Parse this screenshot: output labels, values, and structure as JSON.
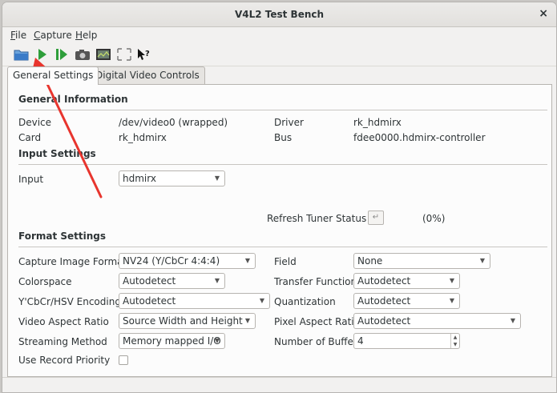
{
  "window": {
    "title": "V4L2 Test Bench"
  },
  "menu": [
    {
      "mnemonic": "F",
      "rest": "ile"
    },
    {
      "mnemonic": "C",
      "rest": "apture"
    },
    {
      "mnemonic": "H",
      "rest": "elp"
    }
  ],
  "toolbar_icons": [
    "open-folder-icon",
    "start-capture-icon",
    "step-capture-icon",
    "snapshot-camera-icon",
    "video-display-icon",
    "fullscreen-icon",
    "whats-this-help-icon"
  ],
  "tabs": [
    {
      "label": "General Settings",
      "active": true
    },
    {
      "label": "Digital Video Controls",
      "active": false
    }
  ],
  "general_info": {
    "heading": "General Information",
    "device_label": "Device",
    "device_value": "/dev/video0 (wrapped)",
    "driver_label": "Driver",
    "driver_value": "rk_hdmirx",
    "card_label": "Card",
    "card_value": "rk_hdmirx",
    "bus_label": "Bus",
    "bus_value": "fdee0000.hdmirx-controller"
  },
  "input_settings": {
    "heading": "Input Settings",
    "input_label": "Input",
    "input_value": "hdmirx",
    "refresh_label": "Refresh Tuner Status",
    "refresh_pct": "(0%)"
  },
  "format_settings": {
    "heading": "Format Settings",
    "capture_format_label": "Capture Image Formats",
    "capture_format_value": "NV24 (Y/CbCr 4:4:4)",
    "field_label": "Field",
    "field_value": "None",
    "colorspace_label": "Colorspace",
    "colorspace_value": "Autodetect",
    "transfer_label": "Transfer Function",
    "transfer_value": "Autodetect",
    "ycbcr_label": "Y'CbCr/HSV Encoding",
    "ycbcr_value": "Autodetect",
    "quant_label": "Quantization",
    "quant_value": "Autodetect",
    "aspect_label": "Video Aspect Ratio",
    "aspect_value": "Source Width and Height",
    "pixel_aspect_label": "Pixel Aspect Ratio",
    "pixel_aspect_value": "Autodetect",
    "streaming_label": "Streaming Method",
    "streaming_value": "Memory mapped I/O",
    "buffers_label": "Number of Buffers",
    "buffers_value": "4",
    "record_priority_label": "Use Record Priority",
    "record_priority_checked": false
  },
  "colors": {
    "accent_green": "#2e9e3a",
    "annotation_red": "#e8352e",
    "folder_blue": "#3a7bc8"
  }
}
